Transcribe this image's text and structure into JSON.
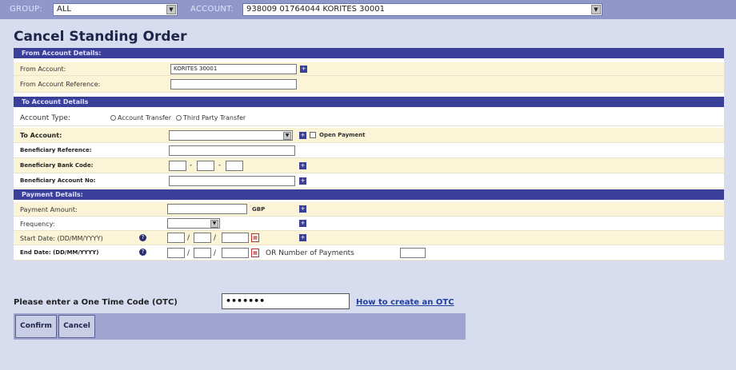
{
  "topbar": {
    "group_label": "GROUP:",
    "group_value": "ALL",
    "account_label": "ACCOUNT:",
    "account_value": "938009 01764044 KORITES 30001"
  },
  "page_title": "Cancel Standing Order",
  "from_section": {
    "header": "From Account Details:",
    "from_account_label": "From Account:",
    "from_account_value": "KORITES 30001",
    "from_ref_label": "From Account Reference:"
  },
  "to_section": {
    "header": "To Account Details",
    "account_type_label": "Account Type:",
    "account_type_options": [
      "Account Transfer",
      "Third Party Transfer"
    ],
    "to_account_label": "To Account:",
    "open_payment_label": "Open Payment",
    "beneficiary_ref_label": "Beneficiary Reference:",
    "beneficiary_bank_code_label": "Beneficiary Bank Code:",
    "beneficiary_account_label": "Beneficiary Account No:"
  },
  "payment_section": {
    "header": "Payment Details:",
    "amount_label": "Payment Amount:",
    "currency": "GBP",
    "frequency_label": "Frequency:",
    "start_date_label": "Start Date: (DD/MM/YYYY)",
    "end_date_label": "End Date: (DD/MM/YYYY)",
    "or_payments_label": "OR Number of Payments"
  },
  "otc": {
    "label": "Please enter a One Time Code (OTC)",
    "value": "•••••••",
    "link": "How to create an OTC"
  },
  "buttons": {
    "confirm": "Confirm",
    "cancel": "Cancel"
  },
  "icons": {
    "plus": "plus-icon",
    "help": "help-icon",
    "calendar": "calendar-icon",
    "dropdown": "chevron-down-icon"
  }
}
